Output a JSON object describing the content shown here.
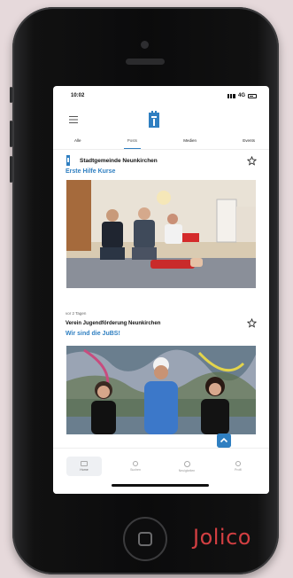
{
  "status": {
    "time": "10:02",
    "network": "4G"
  },
  "tabs": [
    "Alle",
    "Posts",
    "Medien",
    "Events"
  ],
  "posts": [
    {
      "org": "Stadtgemeinde Neunkirchen",
      "title": "Erste Hilfe Kurse",
      "meta": ""
    },
    {
      "org": "Verein Jugendförderung Neunkirchen",
      "title": "Wir sind die JuBS!",
      "meta": "vor 2 Tagen"
    }
  ],
  "bottom_nav": [
    "Home",
    "Suchen",
    "Neuigkeiten",
    "Profil"
  ],
  "brand": "Jolico",
  "colors": {
    "accent": "#2f7fc1",
    "brand": "#d23f42"
  },
  "icons": {
    "menu": "menu-icon",
    "logo": "city-logo-icon",
    "favorite": "star-icon",
    "scroll": "arrow-up-icon"
  }
}
